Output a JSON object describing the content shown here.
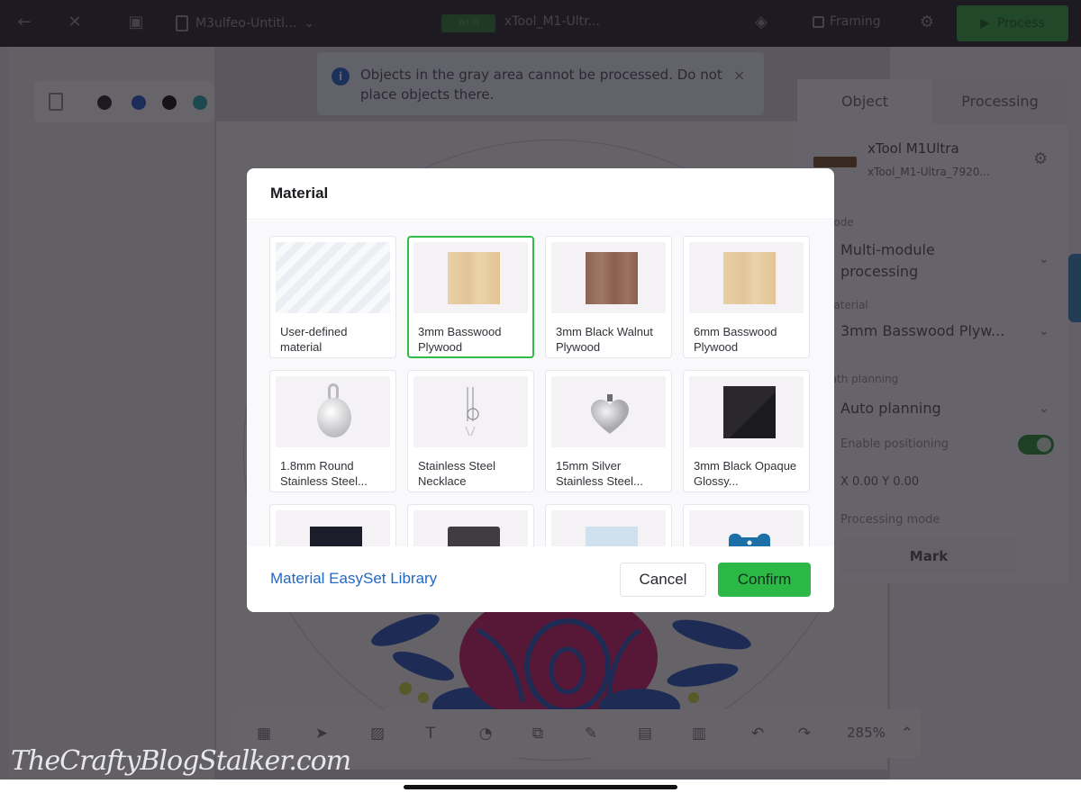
{
  "topbar": {
    "back_icon": "arrow-left-icon",
    "tool_icon": "x-tool-icon",
    "calendar_icon": "calendar-icon",
    "file_name": "M3ulfeo-Untitl...",
    "device_badge": "Wi-Fi",
    "device_name": "xTool_M1-Ultr...",
    "framing_label": "Framing",
    "process_label": "Process"
  },
  "color_toolbar": {
    "swatches": [
      "#1a1a1e",
      "#1d54c4",
      "#050507",
      "#16a3a8"
    ]
  },
  "notice": {
    "message": "Objects in the gray area cannot be processed. Do not place objects there.",
    "close": "×"
  },
  "right_panel": {
    "tabs": [
      {
        "label": "Object",
        "active": false
      },
      {
        "label": "Processing",
        "active": true
      }
    ],
    "device_name": "xTool M1Ultra",
    "device_sub": "xTool_M1-Ultra_7920...",
    "mode_label": "Mode",
    "mode_value": "Multi-module processing",
    "material_label": "Material",
    "material_value": "3mm Basswood Plyw...",
    "planning_label": "Path planning",
    "planning_value": "Auto planning",
    "positioning_label": "Enable positioning",
    "positioning_enabled": true,
    "coords": "X 0.00    Y 0.00",
    "method_label": "Processing mode",
    "method_value": "Mark"
  },
  "bottom_toolbar": {
    "zoom": "285%"
  },
  "modal": {
    "title": "Material",
    "materials": [
      {
        "label": "User-defined material",
        "selected": false,
        "thumb": "stripes"
      },
      {
        "label": "3mm Basswood Plywood",
        "selected": true,
        "thumb": "basswood"
      },
      {
        "label": "3mm Black Walnut Plywood",
        "selected": false,
        "thumb": "walnut"
      },
      {
        "label": "6mm Basswood Plywood",
        "selected": false,
        "thumb": "basswood"
      },
      {
        "label": "1.8mm Round Stainless Steel...",
        "selected": false,
        "thumb": "round-pendant"
      },
      {
        "label": "Stainless Steel Necklace",
        "selected": false,
        "thumb": "necklace"
      },
      {
        "label": "15mm Silver Stainless Steel...",
        "selected": false,
        "thumb": "heart-pendant"
      },
      {
        "label": "3mm Black Opaque Glossy...",
        "selected": false,
        "thumb": "black-acrylic"
      },
      {
        "label": "",
        "selected": false,
        "thumb": "dark-card"
      },
      {
        "label": "",
        "selected": false,
        "thumb": "slate"
      },
      {
        "label": "",
        "selected": false,
        "thumb": "clear-acrylic"
      },
      {
        "label": "",
        "selected": false,
        "thumb": "blue-tag"
      }
    ],
    "library_link": "Material EasySet Library",
    "cancel_label": "Cancel",
    "confirm_label": "Confirm"
  },
  "watermark": "TheCraftyBlogStalker.com"
}
